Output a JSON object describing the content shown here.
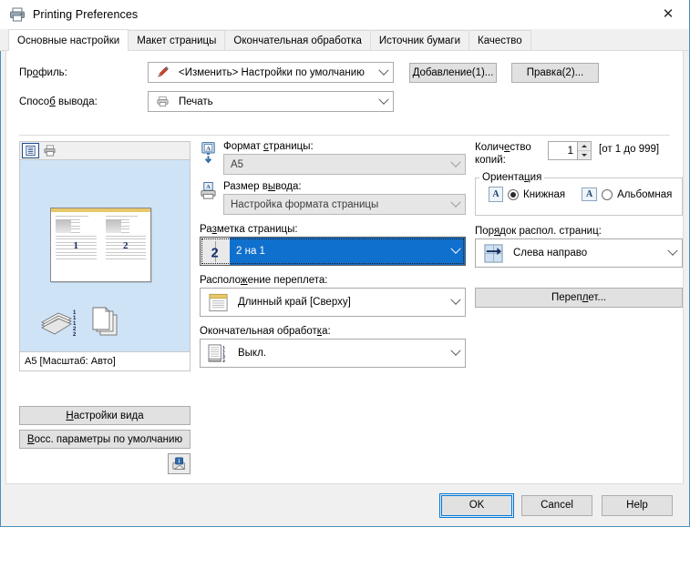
{
  "window": {
    "title": "Printing Preferences",
    "icon": "printer-icon",
    "close_label": "✕",
    "accent_color": "#4a90b8"
  },
  "tabs": [
    {
      "label": "Основные настройки",
      "active": true
    },
    {
      "label": "Макет страницы",
      "active": false
    },
    {
      "label": "Окончательная обработка",
      "active": false
    },
    {
      "label": "Источник бумаги",
      "active": false
    },
    {
      "label": "Качество",
      "active": false
    }
  ],
  "profile": {
    "label_pre": "Пр",
    "label_accel": "о",
    "label_post": "филь:",
    "value": "<Изменить> Настройки по умолчанию",
    "icon": "pencil-icon",
    "add_button": "Добавление(1)...",
    "edit_button": "Правка(2)..."
  },
  "output_method": {
    "label_pre": "Спосо",
    "label_accel": "б",
    "label_post": " вывода:",
    "value": "Печать",
    "icon": "printer-small-icon"
  },
  "preview": {
    "tool_document": "document-view-icon",
    "tool_printer": "printer-view-icon",
    "page_numbers": [
      "1",
      "2"
    ],
    "status": "A5 [Масштаб: Авто]",
    "stack_icon": "paper-stack-icon",
    "copies_icon": "copies-icon"
  },
  "center": {
    "page_size": {
      "label_pre": "Формат ",
      "label_accel": "с",
      "label_post": "траницы:",
      "value": "A5",
      "icon": "monitor-page-icon",
      "disabled": true
    },
    "output_size": {
      "label_pre": "Размер в",
      "label_accel": "ы",
      "label_post": "вода:",
      "value": "Настройка формата страницы",
      "icon": "printer-page-icon",
      "disabled": true
    },
    "page_layout": {
      "label_pre": "Ра",
      "label_accel": "з",
      "label_post": "метка страницы:",
      "value": "2 на 1",
      "icon": "two-up-icon",
      "icon_text": "2",
      "selected": true,
      "selection_color": "#1070cd"
    },
    "binding_location": {
      "label_pre": "Располо",
      "label_accel": "ж",
      "label_post": "ение переплета:",
      "value": "Длинный край [Сверху]",
      "icon": "long-edge-top-icon"
    },
    "finishing": {
      "label_pre": "Окончательная обработ",
      "label_accel": "к",
      "label_post": "а:",
      "value": "Выкл.",
      "icon": "collate-off-icon"
    }
  },
  "right": {
    "copies": {
      "label_pre": "Колич",
      "label_accel": "е",
      "label_post": "ство",
      "label_line2": "копий:",
      "value": "1",
      "range": "[от 1 до 999]"
    },
    "orientation": {
      "legend_pre": "Ориента",
      "legend_accel": "ц",
      "legend_post": "ия",
      "portrait": {
        "label": "Книжная",
        "selected": true,
        "icon": "portrait-icon"
      },
      "landscape": {
        "label": "Альбомная",
        "selected": false,
        "icon": "landscape-icon"
      }
    },
    "page_order": {
      "label_pre": "Пор",
      "label_accel": "я",
      "label_post": "док распол. страниц:",
      "value": "Слева направо",
      "icon": "left-to-right-icon"
    },
    "binding_button": {
      "label_pre": "Переп",
      "label_accel": "л",
      "label_post": "ет..."
    }
  },
  "bottom_left": {
    "view_settings": {
      "accel": "Н",
      "rest": "астройки вида"
    },
    "restore_defaults": {
      "accel": "В",
      "rest": "осс. параметры по умолчанию"
    },
    "info_button": "info-printer-icon"
  },
  "footer": {
    "ok": "OK",
    "cancel": "Cancel",
    "help": "Help",
    "focus_color": "#0078d7"
  }
}
